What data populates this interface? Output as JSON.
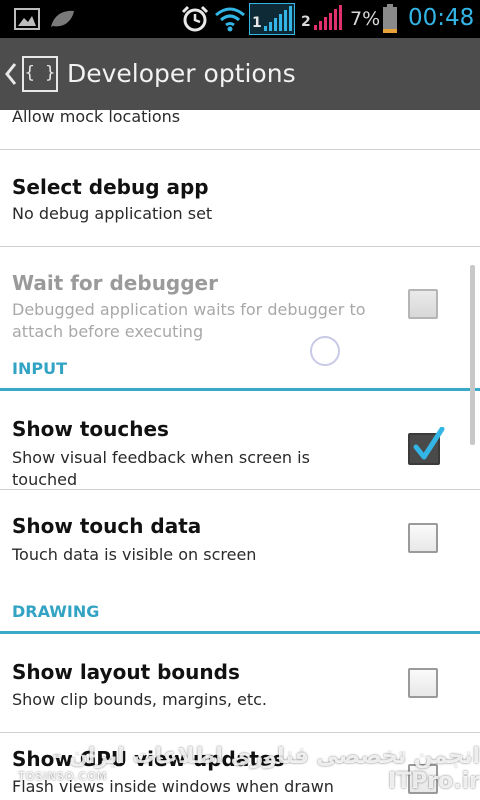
{
  "status_bar": {
    "icons": [
      "image-icon",
      "leaf-icon",
      "alarm-clock-icon",
      "wifi-icon",
      "sim1-signal-icon",
      "sim2-signal-icon",
      "battery-icon"
    ],
    "sim1_label": "1",
    "sim2_label": "2",
    "battery_percent": "7%",
    "time": "00:48",
    "colors": {
      "time": "#33b5e5",
      "sim1_signal": "#33b5e5",
      "sim2_signal": "#e0306e",
      "battery_low": "#e8a23a"
    }
  },
  "action_bar": {
    "back_icon": "back-chevron-icon",
    "app_icon_text": "{ }",
    "title": "Developer options"
  },
  "settings": {
    "allow_mock_locations": {
      "title": "Allow mock locations"
    },
    "select_debug_app": {
      "title": "Select debug app",
      "summary": "No debug application set"
    },
    "wait_for_debugger": {
      "title": "Wait for debugger",
      "summary": "Debugged application waits for debugger to attach before executing",
      "checked": false,
      "enabled": false
    },
    "category_input": "INPUT",
    "show_touches": {
      "title": "Show touches",
      "summary": "Show visual feedback when screen is touched",
      "checked": true
    },
    "show_touch_data": {
      "title": "Show touch data",
      "summary": "Touch data is visible on screen",
      "checked": false
    },
    "category_drawing": "DRAWING",
    "show_layout_bounds": {
      "title": "Show layout bounds",
      "summary": "Show clip bounds, margins, etc.",
      "checked": false
    },
    "show_gpu_view_updates": {
      "title": "Show GPU view updates",
      "summary": "Flash views inside windows when drawn with",
      "checked": false
    }
  },
  "watermark": {
    "text": "انجمن تخصصی فناوری اطلاعات ایران - ITPro.ir",
    "sub": "TOSINSO.COM"
  },
  "accent_color": "#33a3c4"
}
